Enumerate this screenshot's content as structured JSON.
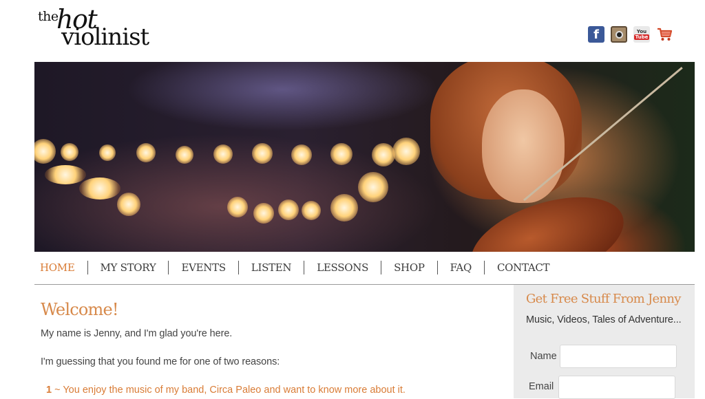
{
  "logo": {
    "the": "the",
    "hot": "hot",
    "violinist": "violinist"
  },
  "social": [
    {
      "name": "facebook-icon",
      "glyph": "f"
    },
    {
      "name": "instagram-icon",
      "glyph": ""
    },
    {
      "name": "youtube-icon",
      "glyph_top": "You",
      "glyph_bottom": "Tube"
    },
    {
      "name": "shopping-cart-icon",
      "glyph": ""
    }
  ],
  "nav": {
    "items": [
      {
        "label": "HOME",
        "active": true
      },
      {
        "label": "MY STORY"
      },
      {
        "label": "EVENTS"
      },
      {
        "label": "LISTEN"
      },
      {
        "label": "LESSONS"
      },
      {
        "label": "SHOP"
      },
      {
        "label": "FAQ"
      },
      {
        "label": "CONTACT"
      }
    ]
  },
  "main": {
    "heading": "Welcome!",
    "p1": "My name is Jenny, and I'm glad you're here.",
    "p2": "I'm guessing that you found me for one of two reasons:",
    "reason1_num": "1",
    "reason1_text": " ~ You enjoy the music of my band, Circa Paleo and want to know more about it."
  },
  "sidebar": {
    "title": "Get Free Stuff From Jenny",
    "subtitle": "Music, Videos, Tales of Adventure...",
    "name_label": "Name",
    "email_label": "Email"
  },
  "colors": {
    "accent": "#d97c36",
    "heading": "#d7894a",
    "sidebar_bg": "#ebebeb"
  }
}
